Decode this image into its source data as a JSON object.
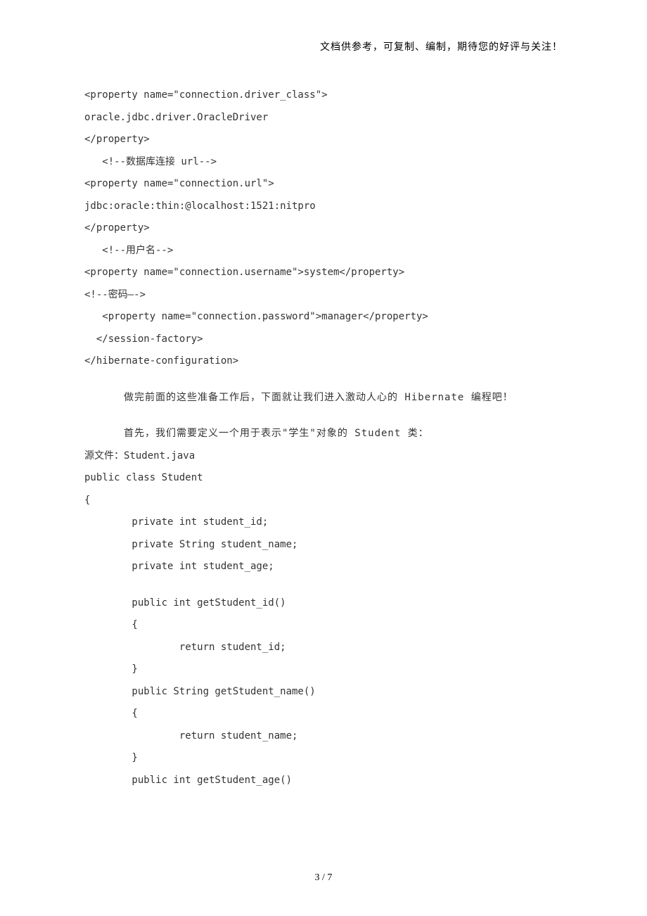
{
  "header": {
    "note": "文档供参考，可复制、编制，期待您的好评与关注！"
  },
  "lines": {
    "l1": "<property name=\"connection.driver_class\">",
    "l2": "oracle.jdbc.driver.OracleDriver",
    "l3": "</property>",
    "l4": "   <!--数据库连接 url-->",
    "l5": "<property name=\"connection.url\">",
    "l6": "jdbc:oracle:thin:@localhost:1521:nitpro",
    "l7": "</property>",
    "l8": "   <!--用户名-->",
    "l9": "<property name=\"connection.username\">system</property>",
    "l10": "<!--密码—->",
    "l11": "   <property name=\"connection.password\">manager</property>",
    "l12": "  </session-factory>",
    "l13": "</hibernate-configuration>",
    "p1": "做完前面的这些准备工作后，下面就让我们进入激动人心的 Hibernate 编程吧！",
    "p2": "首先，我们需要定义一个用于表示\"学生\"对象的 Student 类：",
    "c1": "源文件：Student.java",
    "c2": "public class Student",
    "c3": "{",
    "c4": "private int student_id;",
    "c5": "private String student_name;",
    "c6": "private int student_age;",
    "c7": "public int getStudent_id()",
    "c8": "{",
    "c9": "return student_id;",
    "c10": "}",
    "c11": "public String getStudent_name()",
    "c12": "{",
    "c13": "return student_name;",
    "c14": "}",
    "c15": "public int getStudent_age()"
  },
  "footer": {
    "page": "3 / 7"
  }
}
